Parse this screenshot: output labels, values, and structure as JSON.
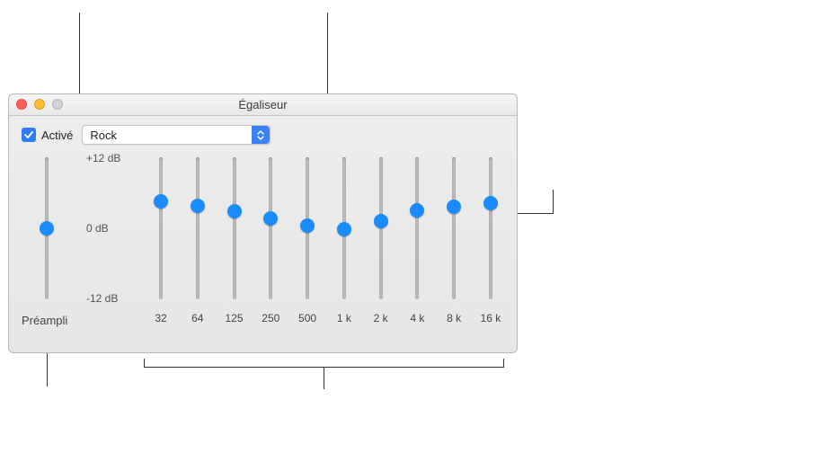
{
  "window": {
    "title": "Égaliseur"
  },
  "controls": {
    "enabled": {
      "checked": true,
      "label": "Activé"
    },
    "preset": {
      "value": "Rock"
    }
  },
  "scale": {
    "max_label": "+12 dB",
    "mid_label": "0 dB",
    "min_label": "-12 dB",
    "min": -12,
    "max": 12
  },
  "preamp": {
    "label": "Préampli",
    "value_db": 0
  },
  "bands": [
    {
      "freq_label": "32",
      "value_db": 4.6
    },
    {
      "freq_label": "64",
      "value_db": 3.8
    },
    {
      "freq_label": "125",
      "value_db": 2.9
    },
    {
      "freq_label": "250",
      "value_db": 1.6
    },
    {
      "freq_label": "500",
      "value_db": 0.4
    },
    {
      "freq_label": "1 k",
      "value_db": -0.2
    },
    {
      "freq_label": "2 k",
      "value_db": 1.2
    },
    {
      "freq_label": "4 k",
      "value_db": 3.0
    },
    {
      "freq_label": "8 k",
      "value_db": 3.6
    },
    {
      "freq_label": "16 k",
      "value_db": 4.2
    }
  ]
}
